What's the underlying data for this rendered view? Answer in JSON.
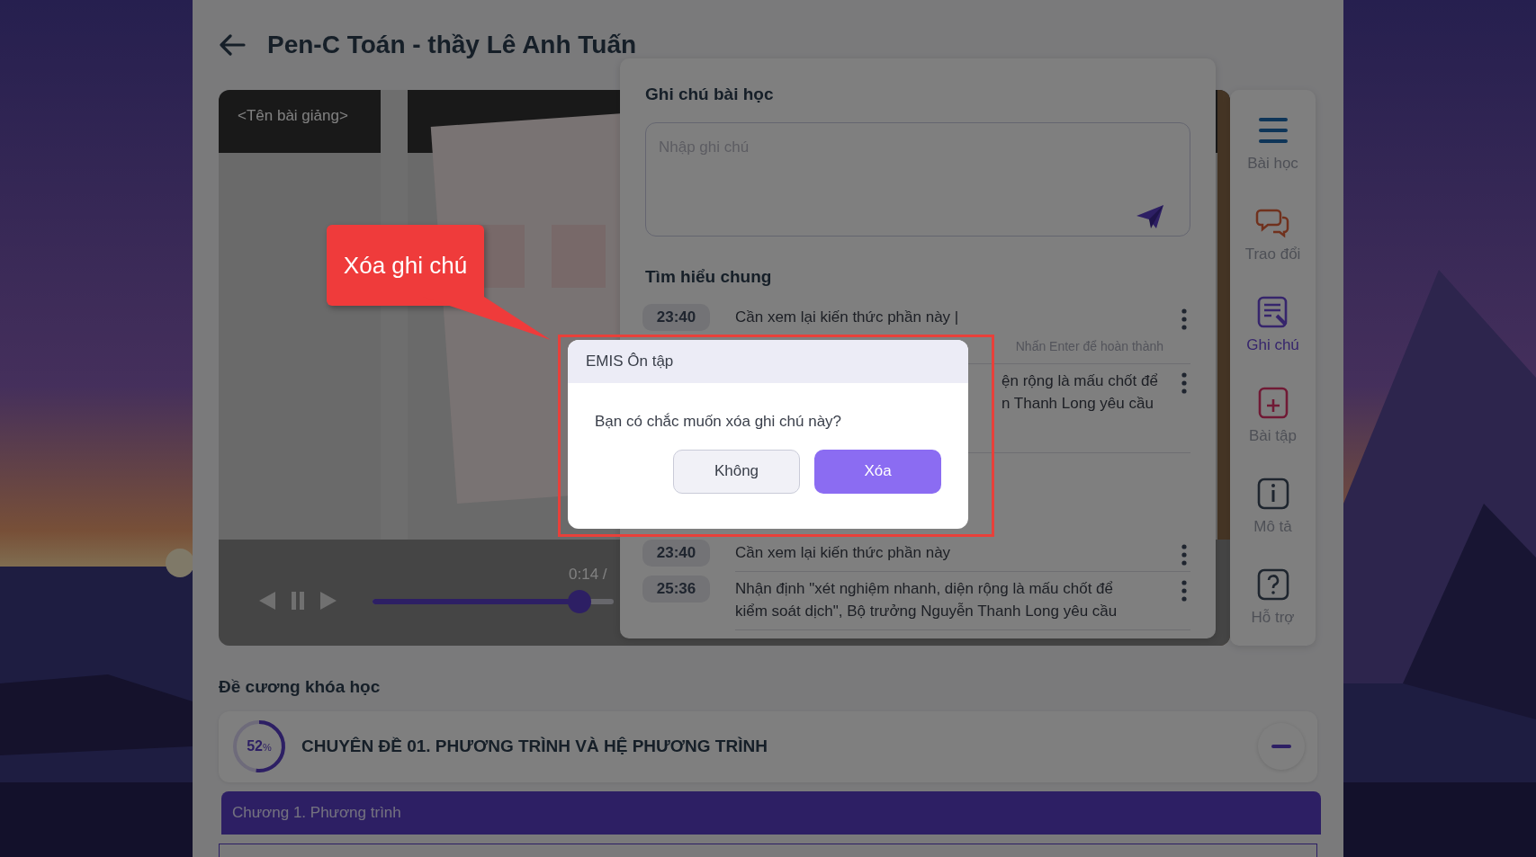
{
  "header": {
    "title": "Pen-C Toán - thầy Lê Anh Tuấn"
  },
  "video": {
    "lesson_name": "<Tên bài giảng>",
    "time": "0:14 /",
    "progress": {
      "level": 0.86
    }
  },
  "notes_panel": {
    "title": "Ghi chú bài học",
    "input": {
      "placeholder": "Nhập ghi chú"
    },
    "section": "Tìm hiểu chung",
    "notes": [
      {
        "time": "23:40",
        "lines": [
          "Cần xem lại kiến thức phần này |"
        ],
        "hint": "Nhấn Enter để hoàn thành"
      },
      {
        "lines": [
          "ện rộng là mấu chốt để",
          "n Thanh Long yêu cầu"
        ]
      },
      {
        "time": "23:40",
        "lines": [
          "Cần xem lại kiến thức phần này"
        ]
      },
      {
        "time": "25:36",
        "lines": [
          "Nhận định \"xét nghiệm nhanh, diện rộng là mấu chốt để",
          "kiểm soát dịch\", Bộ trưởng Nguyễn Thanh Long yêu cầu"
        ]
      }
    ]
  },
  "sidebar": {
    "items": [
      {
        "label": "Bài học",
        "kind": "menu",
        "selected": false
      },
      {
        "label": "Trao đổi",
        "kind": "chat",
        "selected": false
      },
      {
        "label": "Ghi chú",
        "kind": "note",
        "selected": true
      },
      {
        "label": "Bài tập",
        "kind": "exercise",
        "selected": false
      },
      {
        "label": "Mô tả",
        "kind": "info",
        "selected": false
      },
      {
        "label": "Hỗ trợ",
        "kind": "help",
        "selected": false
      }
    ]
  },
  "outline": {
    "title": "Đề cương khóa học",
    "topic": {
      "progress": {
        "level": 0.52,
        "label": "52",
        "unit": "%"
      },
      "title": "CHUYÊN ĐỀ 01. PHƯƠNG TRÌNH VÀ HỆ PHƯƠNG TRÌNH",
      "expanded": true
    },
    "chapters": [
      {
        "title": "Chương 1. Phương trình",
        "selected": true
      }
    ]
  },
  "dialog": {
    "title": "EMIS Ôn tập",
    "message": "Bạn có chắc muốn xóa ghi chú này?",
    "buttons": [
      {
        "label": "Không",
        "kind": "secondary"
      },
      {
        "label": "Xóa",
        "kind": "primary"
      }
    ]
  },
  "annotation": {
    "callout": "Xóa ghi chú"
  }
}
